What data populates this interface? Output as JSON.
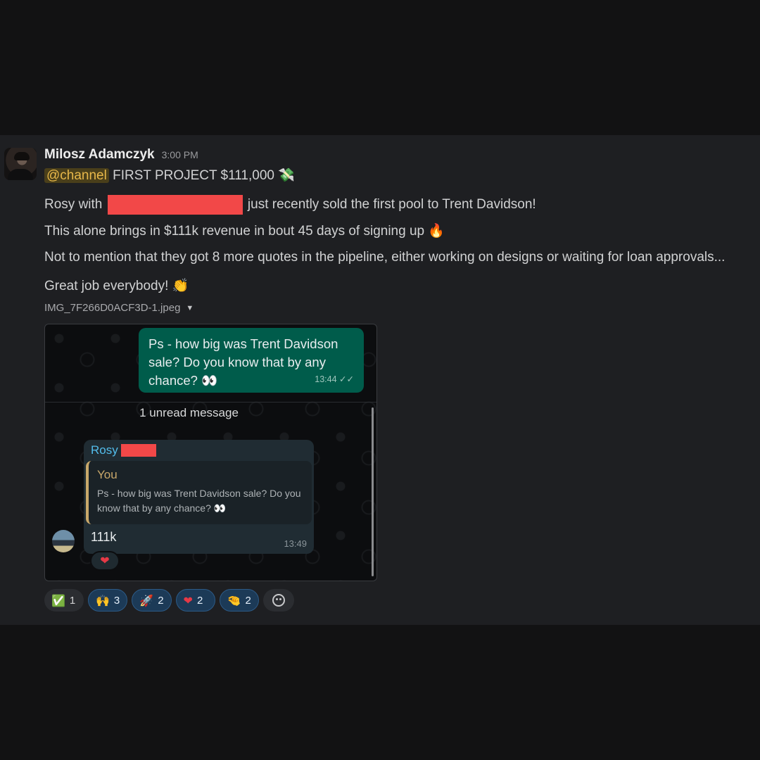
{
  "message": {
    "author": "Milosz Adamczyk",
    "time": "3:00 PM",
    "mention": "@channel",
    "headline": "FIRST PROJECT $111,000",
    "headline_emoji": "💸",
    "line2_before": "Rosy with",
    "line2_after": "just recently sold the first pool to Trent Davidson!",
    "line3": "This alone brings in $111k revenue in bout 45 days of signing up",
    "line3_emoji": "🔥",
    "line4": "Not to mention that they got 8 more quotes in the pipeline, either working on designs or waiting for loan approvals...",
    "line5": "Great job everybody!",
    "line5_emoji": "👏"
  },
  "attachment": {
    "filename": "IMG_7F266D0ACF3D-1.jpeg",
    "caret": "▼"
  },
  "chat": {
    "outgoing_text": "Ps - how big was Trent Davidson sale? Do you know that by any chance? 👀",
    "outgoing_time": "13:44",
    "unread_label": "1 unread message",
    "sender_name": "Rosy",
    "quote_name": "You",
    "quote_text": "Ps - how big was Trent Davidson sale? Do you know that by any chance? 👀",
    "reply_text": "111k",
    "reply_time": "13:49",
    "reaction": "❤"
  },
  "reactions": [
    {
      "emoji": "✅",
      "count": "1",
      "active": false
    },
    {
      "emoji": "🙌",
      "count": "3",
      "active": true
    },
    {
      "emoji": "🚀",
      "count": "2",
      "active": true
    },
    {
      "emoji": "❤",
      "count": "2",
      "active": true
    },
    {
      "emoji": "🤏",
      "count": "2",
      "active": true
    }
  ],
  "colors": {
    "mention_text": "#e8b84a",
    "redaction": "#f24848",
    "outgoing_bubble": "#005c4b",
    "incoming_bubble": "#202c33",
    "sender_name": "#53bdeb",
    "quote_accent": "#c9a86a"
  }
}
